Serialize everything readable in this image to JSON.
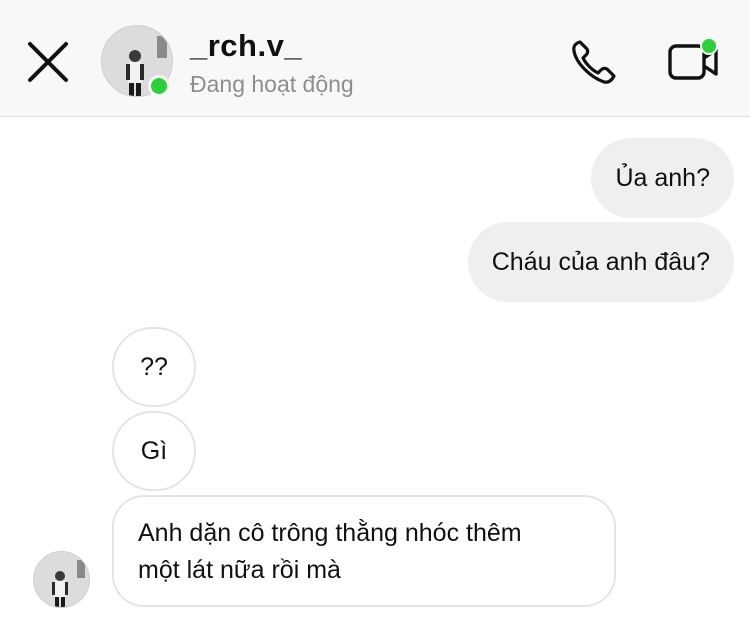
{
  "header": {
    "username": "_rch.v_",
    "status": "Đang hoạt động",
    "online_color": "#2bd13a",
    "icons": {
      "close": "close-icon",
      "call": "phone-icon",
      "video": "video-camera-icon"
    }
  },
  "messages": [
    {
      "direction": "outgoing",
      "text": "Ủa anh?"
    },
    {
      "direction": "outgoing",
      "text": "Cháu của anh đâu?"
    },
    {
      "direction": "incoming",
      "text": "??"
    },
    {
      "direction": "incoming",
      "text": "Gì"
    },
    {
      "direction": "incoming",
      "lines": [
        "Anh dặn cô trông thằng nhóc thêm",
        "một lát nữa rồi mà"
      ]
    }
  ]
}
